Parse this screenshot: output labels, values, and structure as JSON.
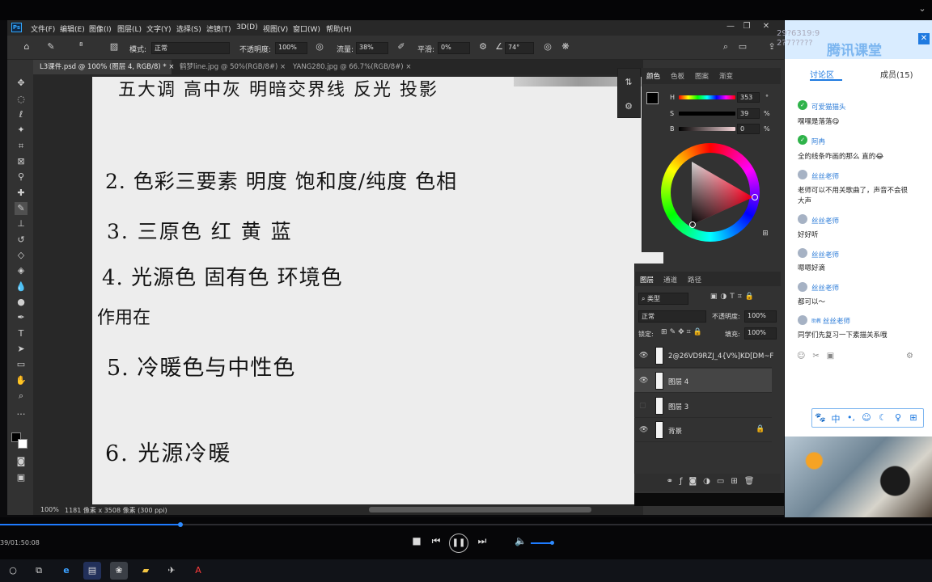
{
  "photoshop": {
    "app_icon": "Ps",
    "menu": [
      "文件(F)",
      "编辑(E)",
      "图像(I)",
      "图层(L)",
      "文字(Y)",
      "选择(S)",
      "滤镜(T)",
      "3D(D)",
      "视图(V)",
      "窗口(W)",
      "帮助(H)"
    ],
    "options": {
      "brush_size": "8",
      "mode_label": "模式:",
      "mode_value": "正常",
      "opacity_label": "不透明度:",
      "opacity_value": "100%",
      "flow_label": "流量:",
      "flow_value": "38%",
      "smoothing_label": "平滑:",
      "smoothing_value": "0%",
      "angle_value": "74°"
    },
    "tabs": [
      {
        "label": "L3课件.psd @ 100% (图层 4, RGB/8) *",
        "active": true
      },
      {
        "label": "鹤梦line.jpg @ 50%(RGB/8#)",
        "active": false
      },
      {
        "label": "YANG280.jpg @ 66.7%(RGB/8#)",
        "active": false
      }
    ],
    "canvas_notes": [
      "五大调   高中灰   明暗交界线   反光   投影",
      "2. 色彩三要素    明度   饱和度/纯度   色相",
      "3. 三原色   红  黄  蓝",
      "4. 光源色        固有色        环境色",
      "作用在",
      "5. 冷暖色与中性色",
      "6. 光源冷暖"
    ],
    "status": {
      "zoom": "100%",
      "doc_info": "1181 像素 x 3508 像素 (300 ppi)"
    },
    "color_panel": {
      "tabs": [
        "颜色",
        "色板",
        "图案",
        "渐变"
      ],
      "h_label": "H",
      "h_value": "353",
      "h_unit": "°",
      "s_label": "S",
      "s_value": "39",
      "s_unit": "%",
      "b_label": "B",
      "b_value": "0",
      "b_unit": "%",
      "h_level": 0.98,
      "s_level": 0.39,
      "b_level": 0.0
    },
    "layers_panel": {
      "tabs": [
        "图层",
        "通道",
        "路径"
      ],
      "filter_label": "类型",
      "blend_mode": "正常",
      "opacity_label": "不透明度:",
      "opacity_value": "100%",
      "lock_label": "锁定:",
      "fill_label": "填充:",
      "fill_value": "100%",
      "layers": [
        {
          "name": "2@26VD9RZJ_4{V%]KD[DM~F",
          "visible": true,
          "selected": false
        },
        {
          "name": "图层 4",
          "visible": true,
          "selected": true
        },
        {
          "name": "图层 3",
          "visible": false,
          "selected": false
        },
        {
          "name": "背景",
          "visible": true,
          "selected": false,
          "locked": true
        }
      ]
    }
  },
  "chat": {
    "overlay_text_1": "29?6319:9",
    "overlay_text_2": "2?7?????",
    "brand": "腾讯课堂",
    "tab_discussion": "讨论区",
    "tab_members": "成员(15)",
    "messages": [
      {
        "user": "可爱猫猫头",
        "text": "嘿嘿是落落😋"
      },
      {
        "user": "阿冉",
        "text": "全的线条咋画的那么 直的😂"
      },
      {
        "user": "丝丝老师",
        "text": "老师可以不用关歌曲了，声音不会很",
        "text2": "大声"
      },
      {
        "user": "丝丝老师",
        "text": "好好听"
      },
      {
        "user": "丝丝老师",
        "text": "嗯嗯好滴"
      },
      {
        "user": "丝丝老师",
        "text": "都可以～"
      },
      {
        "user": "丝丝老师",
        "badge": "助教",
        "text": "同学们先复习一下素描关系哦"
      }
    ],
    "ime": [
      "中",
      "•,",
      "☺",
      "☾",
      "♀",
      "⊞"
    ]
  },
  "video": {
    "time": "39/01:50:08",
    "progress": 0.194,
    "volume": 0.85
  },
  "colors": {
    "ps_bg": "#323232",
    "accent_blue": "#1e7bff",
    "chat_link": "#2e7dd8",
    "wechat_green": "#2fb34a"
  }
}
